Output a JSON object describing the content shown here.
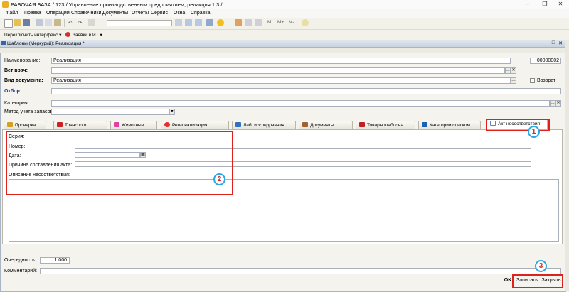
{
  "window": {
    "title": "РАБОЧАЯ БАЗА / 123 /  Управление производственным предприятием, редакция 1.3 /",
    "minimize": "–",
    "restore": "❐",
    "close": "✕"
  },
  "menu": [
    "Файл",
    "Правка",
    "Операции",
    "Справочники",
    "Документы",
    "Отчеты",
    "Сервис",
    "Окна",
    "Справка"
  ],
  "toolbar": {
    "switch_interface": "Переключить интерфейс ▾",
    "requests_it": "Заявки в ИТ ▾",
    "font_buttons": [
      "M",
      "M+",
      "M-"
    ]
  },
  "document": {
    "header_title": "Шаблоны (Меркурий): Реализация *",
    "fields": {
      "name_label": "Наименование:",
      "name_value": "Реализация",
      "code_value": "00000002",
      "vet_label": "Вет врач:",
      "vet_value": "",
      "doc_type_label": "Вид документа:",
      "doc_type_value": "Реализация",
      "return_label": "Возврат",
      "filter_label": "Отбор:",
      "category_label": "Категория:",
      "stock_method_label": "Метод учета запасов:"
    },
    "tabs": [
      {
        "label": "Проверка",
        "color": "#d4a020"
      },
      {
        "label": "Транспорт",
        "color": "#cc2020"
      },
      {
        "label": "Животные",
        "color": "#e040a0"
      },
      {
        "label": "Регионализация",
        "color": "#e03030"
      },
      {
        "label": "Лаб. исследования",
        "color": "#3070c0"
      },
      {
        "label": "Документы",
        "color": "#a06030"
      },
      {
        "label": "Товары шаблона",
        "color": "#c02020"
      },
      {
        "label": "Категории списком",
        "color": "#2060b0"
      },
      {
        "label": "Акт несоответствия",
        "color": "#6080c0"
      }
    ],
    "act": {
      "series_label": "Серия:",
      "number_label": "Номер:",
      "date_label": "Дата:",
      "date_value": " . .",
      "reason_label": "Причина составления акта:",
      "description_label": "Описание несоответствия:"
    },
    "order_label": "Очередность:",
    "order_value": "1 000",
    "comment_label": "Комментарий:",
    "buttons": {
      "ok": "OK",
      "save": "Записать",
      "close": "Закрыть"
    }
  },
  "annotations": [
    "1",
    "2",
    "3"
  ],
  "colors": {
    "annotation_red": "#e0201a",
    "annotation_blue": "#2aa8e0"
  }
}
